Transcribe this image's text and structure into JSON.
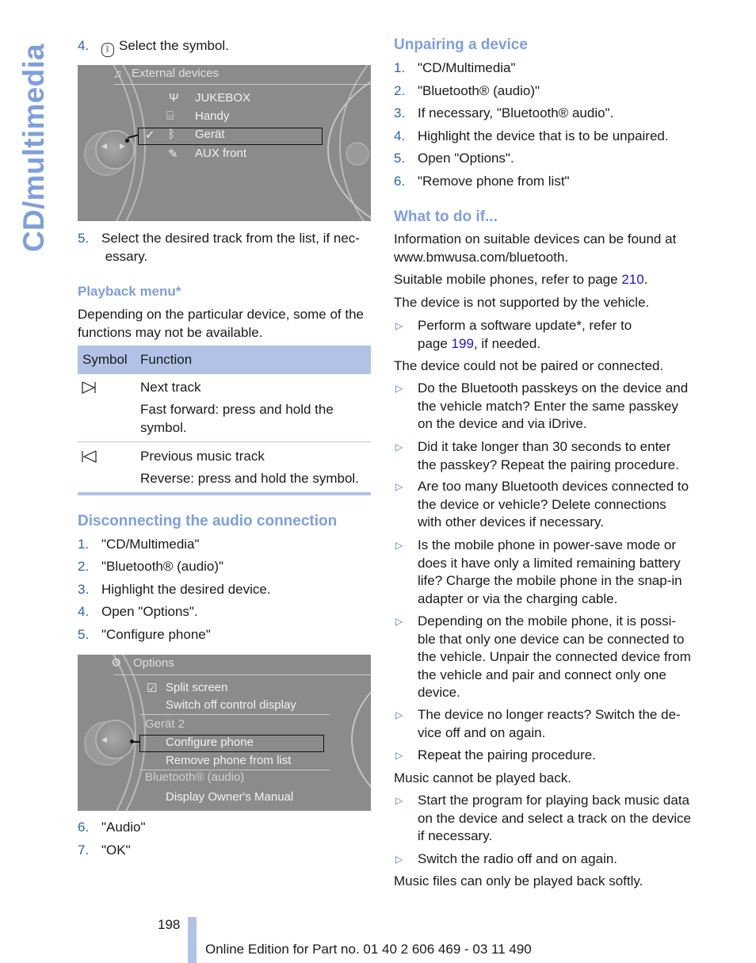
{
  "side_title": "CD/multimedia",
  "left": {
    "step4": {
      "num": "4.",
      "text": "Select the symbol.",
      "icon": "bluetooth-icon"
    },
    "screen1": {
      "title": "External devices",
      "title_icon": "media-note-icon",
      "items": [
        {
          "icon": "usb-icon",
          "label": "JUKEBOX"
        },
        {
          "icon": "phone-holder-icon",
          "label": "Handy"
        },
        {
          "icon": "bluetooth-icon",
          "label": "Gerät",
          "checked": true,
          "selected": true
        },
        {
          "icon": "aux-plug-icon",
          "label": "AUX front"
        }
      ]
    },
    "step5": {
      "num": "5.",
      "text": "Select the desired track from the list, if nec- essary."
    },
    "playback_heading": "Playback menu*",
    "playback_text": "Depending on the particular device, some of the functions may not be available.",
    "table": {
      "headers": [
        "Symbol",
        "Function"
      ],
      "rows": [
        {
          "symbol": "next-track-icon",
          "lines": [
            "Next track",
            "Fast forward: press and hold the symbol."
          ]
        },
        {
          "symbol": "previous-track-icon",
          "lines": [
            "Previous music track",
            "Reverse: press and hold the symbol."
          ]
        }
      ]
    },
    "disconnect_heading": "Disconnecting the audio connection",
    "disconnect_steps": [
      {
        "num": "1.",
        "text": "\"CD/Multimedia\""
      },
      {
        "num": "2.",
        "text": "\"Bluetooth® (audio)\""
      },
      {
        "num": "3.",
        "text": "Highlight the desired device."
      },
      {
        "num": "4.",
        "text": "Open \"Options\"."
      },
      {
        "num": "5.",
        "text": "\"Configure phone\""
      }
    ],
    "screen2": {
      "title": "Options",
      "title_icon": "options-icon",
      "items": [
        {
          "label": "Split screen",
          "icon": "checkbox-checked-icon"
        },
        {
          "label": "Switch off control display"
        },
        {
          "label": "Gerät 2",
          "dim": true
        },
        {
          "label": "Configure phone",
          "selected": true
        },
        {
          "label": "Remove phone from list"
        },
        {
          "label": "Bluetooth® (audio)",
          "dim": true
        },
        {
          "label": "Display Owner's Manual"
        }
      ]
    },
    "final_steps": [
      {
        "num": "6.",
        "text": "\"Audio\""
      },
      {
        "num": "7.",
        "text": "\"OK\""
      }
    ]
  },
  "right": {
    "unpair_heading": "Unpairing a device",
    "unpair_steps": [
      {
        "num": "1.",
        "text": "\"CD/Multimedia\""
      },
      {
        "num": "2.",
        "text": "\"Bluetooth® (audio)\""
      },
      {
        "num": "3.",
        "text": "If necessary, \"Bluetooth® audio\"."
      },
      {
        "num": "4.",
        "text": "Highlight the device that is to be unpaired."
      },
      {
        "num": "5.",
        "text": "Open \"Options\"."
      },
      {
        "num": "6.",
        "text": "\"Remove phone from list\""
      }
    ],
    "whatif_heading": "What to do if...",
    "info_text": "Information on suitable devices can be found at www.bmwusa.com/bluetooth.",
    "suitable_pre": "Suitable mobile phones, refer to page ",
    "suitable_link": "210",
    "suitable_post": ".",
    "not_supported": "The device is not supported by the vehicle.",
    "update_pre": "Perform a software update*, refer to page ",
    "update_link": "199",
    "update_post": ", if needed.",
    "not_paired": "The device could not be paired or connected.",
    "pair_bullets": [
      "Do the Bluetooth passkeys on the device and the vehicle match? Enter the same passkey on the device and via iDrive.",
      "Did it take longer than 30 seconds to enter the passkey? Repeat the pairing procedure.",
      "Are too many Bluetooth devices connected to the device or vehicle? Delete connections with other devices if necessary.",
      "Is the mobile phone in power-save mode or does it have only a limited remaining battery life? Charge the mobile phone in the snap-in adapter or via the charging cable.",
      "Depending on the mobile phone, it is possi-ble that only one device can be connected to the vehicle. Unpair the connected device from the vehicle and pair and connect only one device.",
      "The device no longer reacts? Switch the de-vice off and on again.",
      "Repeat the pairing procedure."
    ],
    "no_music": "Music cannot be played back.",
    "music_bullets": [
      "Start the program for playing back music data on the device and select a track on the device if necessary.",
      "Switch the radio off and on again."
    ],
    "soft_music": "Music files can only be played back softly."
  },
  "footer": {
    "page_number": "198",
    "edition": "Online Edition for Part no. 01 40 2 606 469 - 03 11 490"
  },
  "colors": {
    "heading": "#7f9fdb",
    "number": "#2b63b6",
    "link": "#1a1ad0",
    "table_band": "#b2c2e6"
  }
}
